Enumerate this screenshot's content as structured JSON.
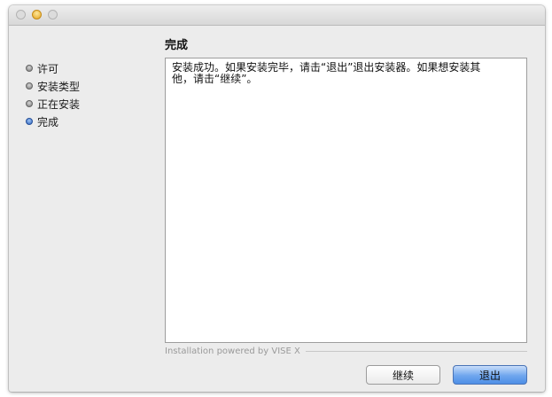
{
  "window": {
    "traffic_lights": [
      {
        "name": "close",
        "color": "#dcdcdc"
      },
      {
        "name": "minimize",
        "color": "#f0b92c"
      },
      {
        "name": "zoom",
        "color": "#dcdcdc"
      }
    ]
  },
  "page": {
    "title": "完成"
  },
  "steps": [
    {
      "label": "许可",
      "active": false
    },
    {
      "label": "安装类型",
      "active": false
    },
    {
      "label": "正在安装",
      "active": false
    },
    {
      "label": "完成",
      "active": true
    }
  ],
  "content": {
    "line1": "安装成功。如果安装完毕，请击“退出”退出安装器。如果想安装其",
    "line2": "他，请击“继续”。"
  },
  "footer": {
    "powered_by": "Installation powered by VISE X"
  },
  "buttons": {
    "continue_label": "继续",
    "quit_label": "退出"
  },
  "colors": {
    "accent_blue": "#4d8ee6",
    "window_bg": "#ececec"
  }
}
